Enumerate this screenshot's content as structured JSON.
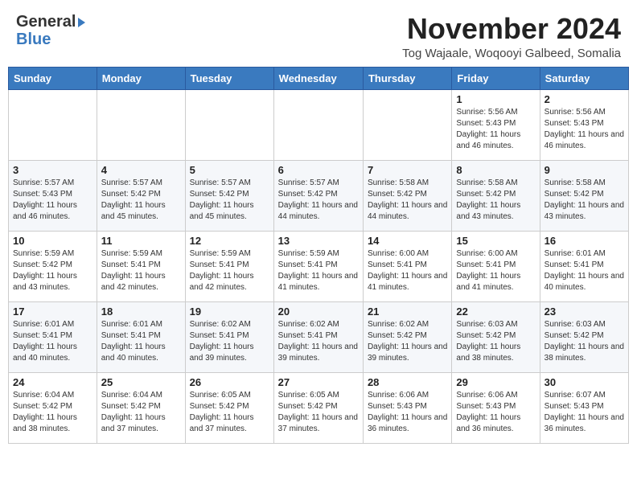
{
  "header": {
    "logo_general": "General",
    "logo_blue": "Blue",
    "month_title": "November 2024",
    "location": "Tog Wajaale, Woqooyi Galbeed, Somalia"
  },
  "calendar": {
    "days_of_week": [
      "Sunday",
      "Monday",
      "Tuesday",
      "Wednesday",
      "Thursday",
      "Friday",
      "Saturday"
    ],
    "weeks": [
      [
        {
          "day": "",
          "info": ""
        },
        {
          "day": "",
          "info": ""
        },
        {
          "day": "",
          "info": ""
        },
        {
          "day": "",
          "info": ""
        },
        {
          "day": "",
          "info": ""
        },
        {
          "day": "1",
          "info": "Sunrise: 5:56 AM\nSunset: 5:43 PM\nDaylight: 11 hours and 46 minutes."
        },
        {
          "day": "2",
          "info": "Sunrise: 5:56 AM\nSunset: 5:43 PM\nDaylight: 11 hours and 46 minutes."
        }
      ],
      [
        {
          "day": "3",
          "info": "Sunrise: 5:57 AM\nSunset: 5:43 PM\nDaylight: 11 hours and 46 minutes."
        },
        {
          "day": "4",
          "info": "Sunrise: 5:57 AM\nSunset: 5:42 PM\nDaylight: 11 hours and 45 minutes."
        },
        {
          "day": "5",
          "info": "Sunrise: 5:57 AM\nSunset: 5:42 PM\nDaylight: 11 hours and 45 minutes."
        },
        {
          "day": "6",
          "info": "Sunrise: 5:57 AM\nSunset: 5:42 PM\nDaylight: 11 hours and 44 minutes."
        },
        {
          "day": "7",
          "info": "Sunrise: 5:58 AM\nSunset: 5:42 PM\nDaylight: 11 hours and 44 minutes."
        },
        {
          "day": "8",
          "info": "Sunrise: 5:58 AM\nSunset: 5:42 PM\nDaylight: 11 hours and 43 minutes."
        },
        {
          "day": "9",
          "info": "Sunrise: 5:58 AM\nSunset: 5:42 PM\nDaylight: 11 hours and 43 minutes."
        }
      ],
      [
        {
          "day": "10",
          "info": "Sunrise: 5:59 AM\nSunset: 5:42 PM\nDaylight: 11 hours and 43 minutes."
        },
        {
          "day": "11",
          "info": "Sunrise: 5:59 AM\nSunset: 5:41 PM\nDaylight: 11 hours and 42 minutes."
        },
        {
          "day": "12",
          "info": "Sunrise: 5:59 AM\nSunset: 5:41 PM\nDaylight: 11 hours and 42 minutes."
        },
        {
          "day": "13",
          "info": "Sunrise: 5:59 AM\nSunset: 5:41 PM\nDaylight: 11 hours and 41 minutes."
        },
        {
          "day": "14",
          "info": "Sunrise: 6:00 AM\nSunset: 5:41 PM\nDaylight: 11 hours and 41 minutes."
        },
        {
          "day": "15",
          "info": "Sunrise: 6:00 AM\nSunset: 5:41 PM\nDaylight: 11 hours and 41 minutes."
        },
        {
          "day": "16",
          "info": "Sunrise: 6:01 AM\nSunset: 5:41 PM\nDaylight: 11 hours and 40 minutes."
        }
      ],
      [
        {
          "day": "17",
          "info": "Sunrise: 6:01 AM\nSunset: 5:41 PM\nDaylight: 11 hours and 40 minutes."
        },
        {
          "day": "18",
          "info": "Sunrise: 6:01 AM\nSunset: 5:41 PM\nDaylight: 11 hours and 40 minutes."
        },
        {
          "day": "19",
          "info": "Sunrise: 6:02 AM\nSunset: 5:41 PM\nDaylight: 11 hours and 39 minutes."
        },
        {
          "day": "20",
          "info": "Sunrise: 6:02 AM\nSunset: 5:41 PM\nDaylight: 11 hours and 39 minutes."
        },
        {
          "day": "21",
          "info": "Sunrise: 6:02 AM\nSunset: 5:42 PM\nDaylight: 11 hours and 39 minutes."
        },
        {
          "day": "22",
          "info": "Sunrise: 6:03 AM\nSunset: 5:42 PM\nDaylight: 11 hours and 38 minutes."
        },
        {
          "day": "23",
          "info": "Sunrise: 6:03 AM\nSunset: 5:42 PM\nDaylight: 11 hours and 38 minutes."
        }
      ],
      [
        {
          "day": "24",
          "info": "Sunrise: 6:04 AM\nSunset: 5:42 PM\nDaylight: 11 hours and 38 minutes."
        },
        {
          "day": "25",
          "info": "Sunrise: 6:04 AM\nSunset: 5:42 PM\nDaylight: 11 hours and 37 minutes."
        },
        {
          "day": "26",
          "info": "Sunrise: 6:05 AM\nSunset: 5:42 PM\nDaylight: 11 hours and 37 minutes."
        },
        {
          "day": "27",
          "info": "Sunrise: 6:05 AM\nSunset: 5:42 PM\nDaylight: 11 hours and 37 minutes."
        },
        {
          "day": "28",
          "info": "Sunrise: 6:06 AM\nSunset: 5:43 PM\nDaylight: 11 hours and 36 minutes."
        },
        {
          "day": "29",
          "info": "Sunrise: 6:06 AM\nSunset: 5:43 PM\nDaylight: 11 hours and 36 minutes."
        },
        {
          "day": "30",
          "info": "Sunrise: 6:07 AM\nSunset: 5:43 PM\nDaylight: 11 hours and 36 minutes."
        }
      ]
    ]
  }
}
